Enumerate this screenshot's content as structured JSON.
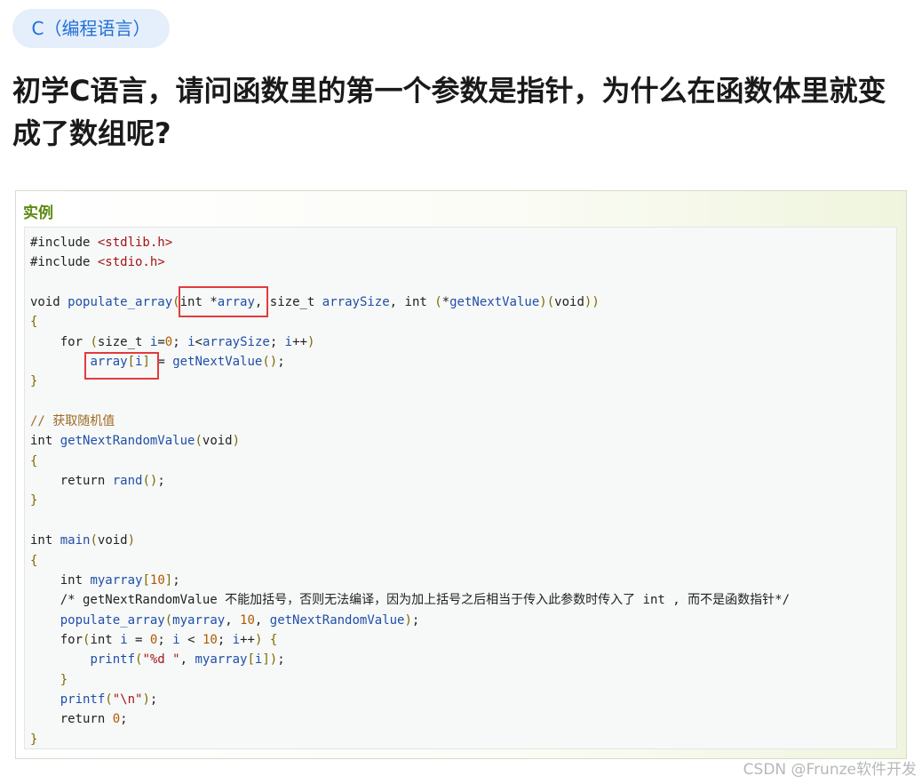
{
  "tag": {
    "label": "C（编程语言）"
  },
  "question": {
    "title": "初学C语言，请问函数里的第一个参数是指针，为什么在函数体里就变成了数组呢?"
  },
  "example": {
    "label": "实例"
  },
  "code_lines": [
    "#include <stdlib.h>",
    "#include <stdio.h>",
    "",
    "void populate_array(int *array, size_t arraySize, int (*getNextValue)(void))",
    "{",
    "    for (size_t i=0; i<arraySize; i++)",
    "        array[i] = getNextValue();",
    "}",
    "",
    "// 获取随机值",
    "int getNextRandomValue(void)",
    "{",
    "    return rand();",
    "}",
    "",
    "int main(void)",
    "{",
    "    int myarray[10];",
    "    /* getNextRandomValue 不能加括号，否则无法编译，因为加上括号之后相当于传入此参数时传入了 int , 而不是函数指针*/",
    "    populate_array(myarray, 10, getNextRandomValue);",
    "    for(int i = 0; i < 10; i++) {",
    "        printf(\"%d \", myarray[i]);",
    "    }",
    "    printf(\"\\n\");",
    "    return 0;",
    "}"
  ],
  "highlights": [
    {
      "text": "int *array"
    },
    {
      "text": "array[i]"
    }
  ],
  "watermark": "CSDN @Frunze软件开发"
}
